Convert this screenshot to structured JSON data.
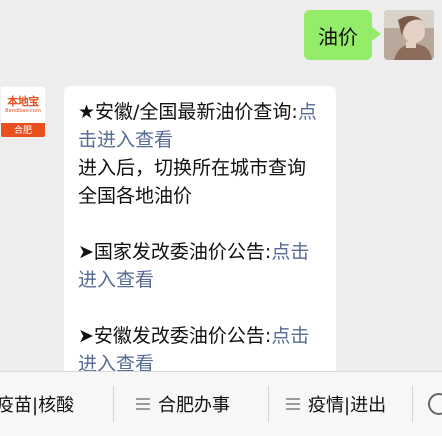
{
  "outgoing": {
    "text": "油价"
  },
  "incoming": {
    "avatar": {
      "brand": "本地宝",
      "domain": "Bendibao.com",
      "city": "合肥"
    },
    "line1_prefix": "★安徽/全国最新油价查询:",
    "line1_link": "点击进入查看",
    "line2": "进入后，切换所在城市查询全国各地油价",
    "line3_prefix": "➤国家发改委油价公告:",
    "line3_link": "点击进入查看",
    "line4_prefix": "➤安徽发改委油价公告:",
    "line4_link": "点击进入查看"
  },
  "menu": {
    "items": [
      {
        "label": "疫苗|核酸"
      },
      {
        "label": "合肥办事"
      },
      {
        "label": "疫情|进出"
      }
    ]
  }
}
